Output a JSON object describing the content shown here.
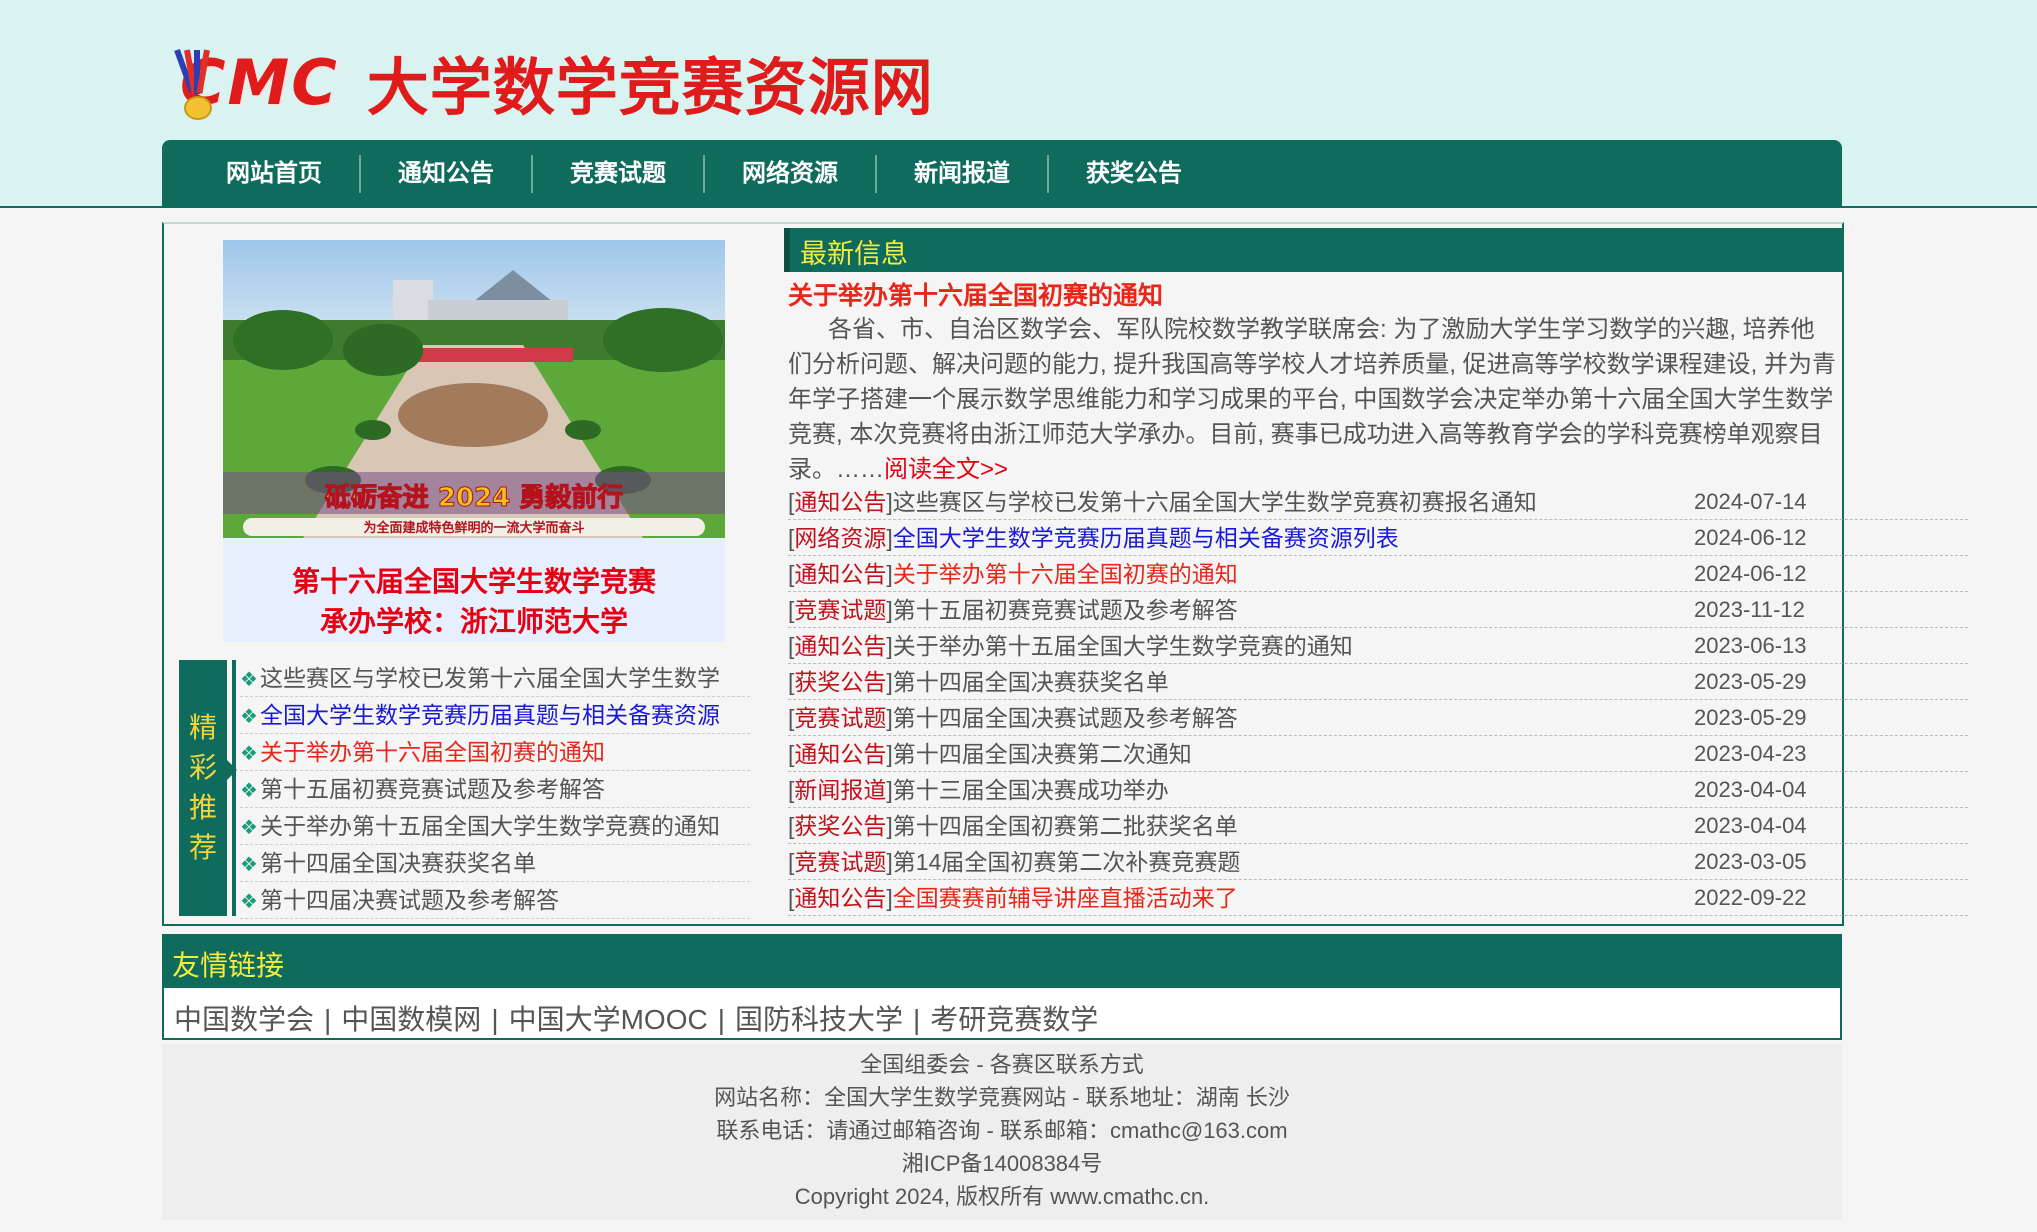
{
  "header": {
    "logo_mark": "CMC",
    "site_title": "大学数学竞赛资源网"
  },
  "nav": {
    "items": [
      "网站首页",
      "通知公告",
      "竞赛试题",
      "网络资源",
      "新闻报道",
      "获奖公告"
    ]
  },
  "banner": {
    "photo_text": "砥砺奋进 2024 勇毅前行",
    "photo_subtext": "为全面建成特色鲜明的一流大学而奋斗",
    "line1": "第十六届全国大学生数学竞赛",
    "line2": "承办学校：浙江师范大学"
  },
  "recommend": {
    "label": [
      "精",
      "彩",
      "推",
      "荐"
    ],
    "items": [
      {
        "text": "这些赛区与学校已发第十六届全国大学生数学",
        "color": "#555555"
      },
      {
        "text": "全国大学生数学竞赛历届真题与相关备赛资源",
        "color": "#1a1ad6"
      },
      {
        "text": "关于举办第十六届全国初赛的通知",
        "color": "#e8271a"
      },
      {
        "text": "第十五届初赛竞赛试题及参考解答",
        "color": "#555555"
      },
      {
        "text": "关于举办第十五届全国大学生数学竞赛的通知",
        "color": "#555555"
      },
      {
        "text": "第十四届全国决赛获奖名单",
        "color": "#555555"
      },
      {
        "text": "第十四届决赛试题及参考解答",
        "color": "#555555"
      }
    ]
  },
  "latest": {
    "heading": "最新信息",
    "feature_title": "关于举办第十六届全国初赛的通知",
    "feature_body": "各省、市、自治区数学会、军队院校数学教学联席会: 为了激励大学生学习数学的兴趣, 培养他们分析问题、解决问题的能力, 提升我国高等学校人才培养质量, 促进高等学校数学课程建设, 并为青年学子搭建一个展示数学思维能力和学习成果的平台, 中国数学会决定举办第十六届全国大学生数学竞赛, 本次竞赛将由浙江师范大学承办。目前, 赛事已成功进入高等教育学会的学科竞赛榜单观察目录。……",
    "read_more": "阅读全文>>",
    "news": [
      {
        "cat": "通知公告",
        "title": "这些赛区与学校已发第十六届全国大学生数学竞赛初赛报名通知",
        "date": "2024-07-14",
        "color": "#555555"
      },
      {
        "cat": "网络资源",
        "title": "全国大学生数学竞赛历届真题与相关备赛资源列表",
        "date": "2024-06-12",
        "color": "#1a1ad6"
      },
      {
        "cat": "通知公告",
        "title": "关于举办第十六届全国初赛的通知",
        "date": "2024-06-12",
        "color": "#e8271a"
      },
      {
        "cat": "竞赛试题",
        "title": "第十五届初赛竞赛试题及参考解答",
        "date": "2023-11-12",
        "color": "#555555"
      },
      {
        "cat": "通知公告",
        "title": "关于举办第十五届全国大学生数学竞赛的通知",
        "date": "2023-06-13",
        "color": "#555555"
      },
      {
        "cat": "获奖公告",
        "title": "第十四届全国决赛获奖名单",
        "date": "2023-05-29",
        "color": "#555555"
      },
      {
        "cat": "竞赛试题",
        "title": "第十四届全国决赛试题及参考解答",
        "date": "2023-05-29",
        "color": "#555555"
      },
      {
        "cat": "通知公告",
        "title": "第十四届全国决赛第二次通知",
        "date": "2023-04-23",
        "color": "#555555"
      },
      {
        "cat": "新闻报道",
        "title": "第十三届全国决赛成功举办",
        "date": "2023-04-04",
        "color": "#555555"
      },
      {
        "cat": "获奖公告",
        "title": "第十四届全国初赛第二批获奖名单",
        "date": "2023-04-04",
        "color": "#555555"
      },
      {
        "cat": "竞赛试题",
        "title": "第14届全国初赛第二次补赛竞赛题",
        "date": "2023-03-05",
        "color": "#555555"
      },
      {
        "cat": "通知公告",
        "title": "全国赛赛前辅导讲座直播活动来了",
        "date": "2022-09-22",
        "color": "#e8271a"
      }
    ]
  },
  "links": {
    "heading": "友情链接",
    "items": [
      "中国数学会",
      "中国数模网",
      "中国大学MOOC",
      "国防科技大学",
      "考研竞赛数学"
    ],
    "separator": "|"
  },
  "footer": {
    "line1": "全国组委会 - 各赛区联系方式",
    "line2": "网站名称：全国大学生数学竞赛网站 - 联系地址：湖南 长沙",
    "line3": "联系电话：请通过邮箱咨询 - 联系邮箱：cmathc@163.com",
    "line4": "湘ICP备14008384号",
    "line5": "Copyright 2024, 版权所有 www.cmathc.cn."
  },
  "colors": {
    "theme_green": "#0f6b5c",
    "title_red": "#e01b1b",
    "heading_yellow": "#f6ec3d",
    "header_bg": "#d8f3f0"
  }
}
